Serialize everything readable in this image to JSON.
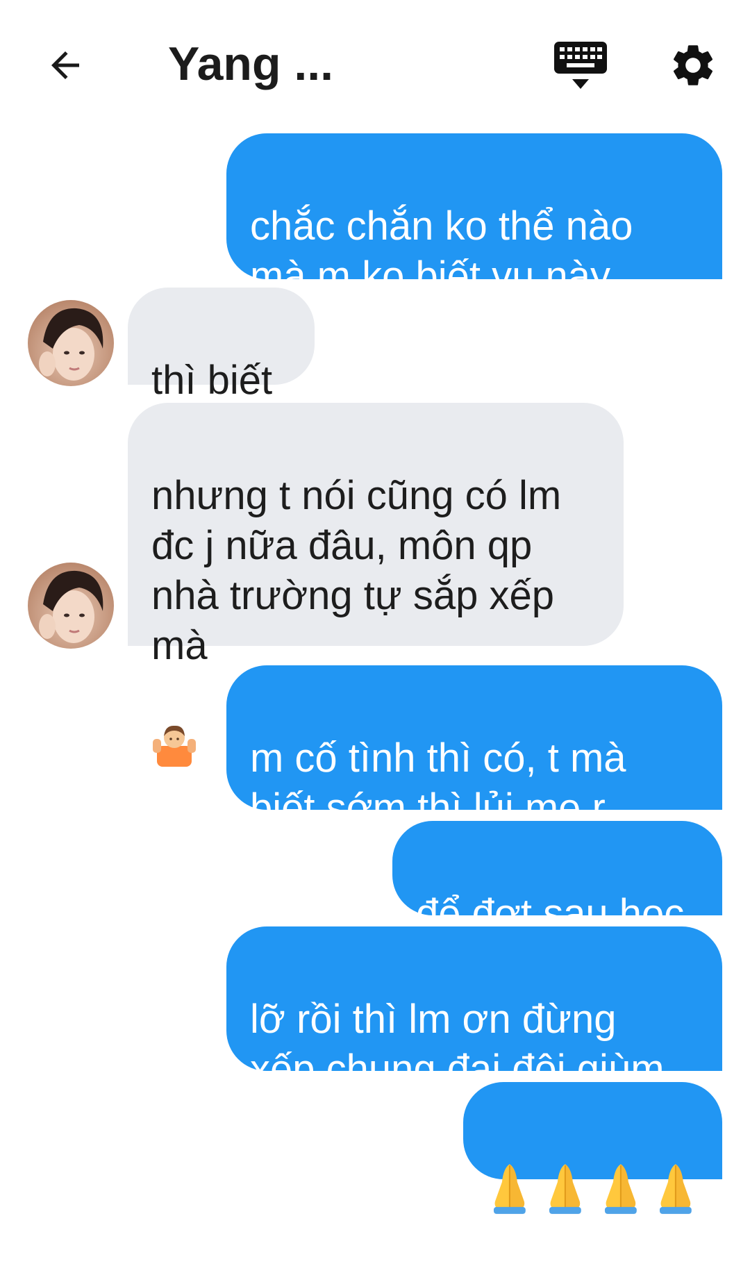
{
  "header": {
    "title": "Yang ..."
  },
  "messages": [
    {
      "side": "out",
      "text": "chắc chắn ko thể nào\nmà m ko biết vụ này"
    },
    {
      "side": "in",
      "text": "thì biết"
    },
    {
      "side": "in",
      "text": "nhưng t nói cũng có lm\nđc j nữa đâu, môn qp\nnhà trường tự sắp xếp\nmà"
    },
    {
      "side": "out",
      "text": "m cố tình thì có, t mà\nbiết sớm thì lủi mẹ r"
    },
    {
      "side": "out",
      "text": "để đợt sau học"
    },
    {
      "side": "out",
      "text": "lỡ rồi thì lm ơn đừng\nxếp chung đại đội giùm"
    },
    {
      "side": "out",
      "icons": [
        "folded-hands-emoji",
        "folded-hands-emoji",
        "folded-hands-emoji",
        "folded-hands-emoji"
      ]
    }
  ],
  "icons": {
    "back": "arrow-back-icon",
    "keyboard": "keyboard-icon",
    "settings": "gear-icon",
    "shrug": "person-shrugging-emoji",
    "pray": "folded-hands-emoji"
  },
  "colors": {
    "outgoing_bubble": "#2196f3",
    "incoming_bubble": "#e9ebef",
    "outgoing_text": "#ffffff",
    "incoming_text": "#1d1d1d"
  }
}
